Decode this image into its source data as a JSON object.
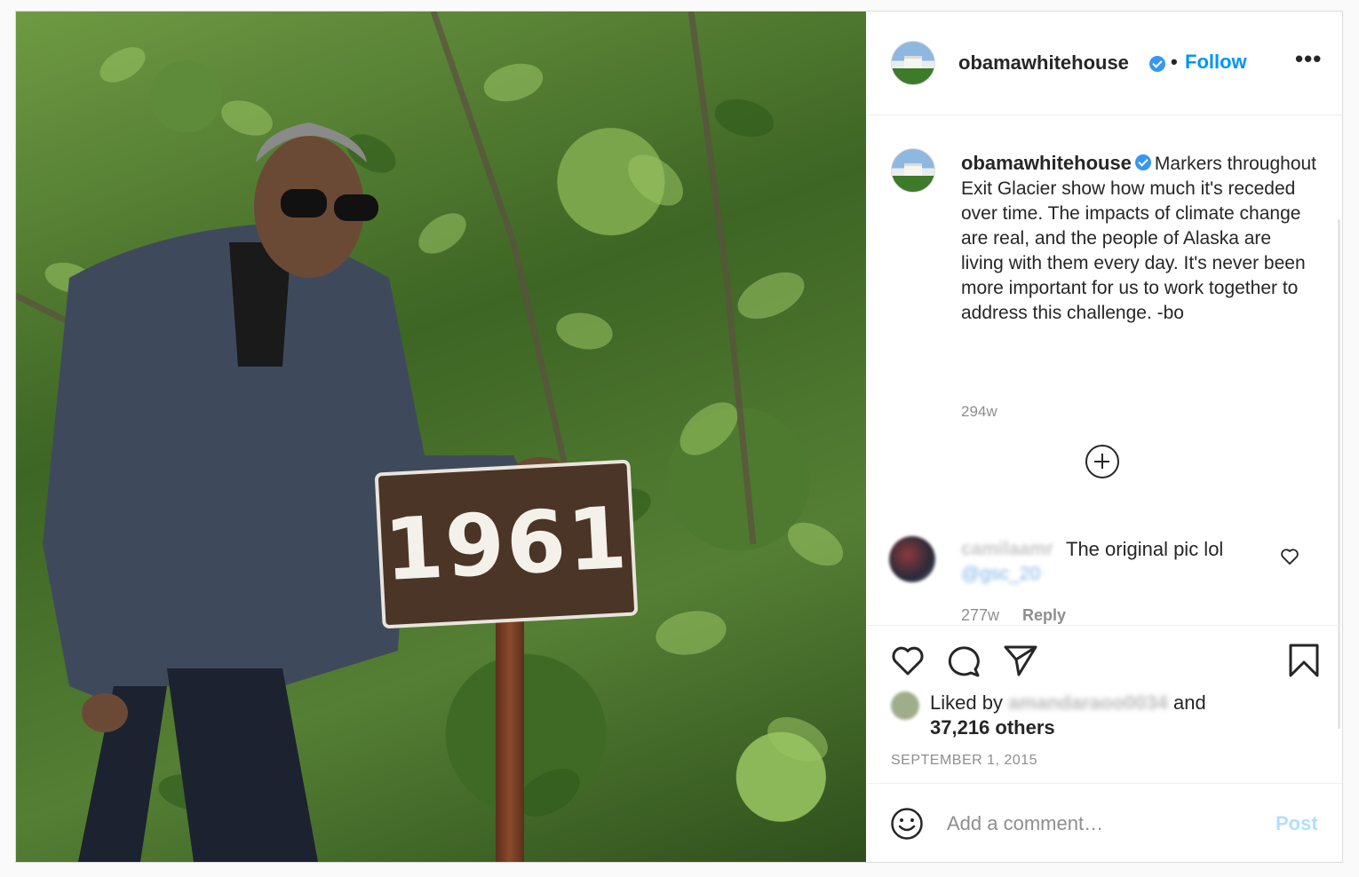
{
  "photo": {
    "alt": "Man in sunglasses and dark jacket posing beside a 1961 marker sign in green foliage",
    "sign_text": "1961"
  },
  "header": {
    "username": "obamawhitehouse",
    "dot": "•",
    "follow_label": "Follow",
    "more_label": "•••"
  },
  "caption": {
    "username": "obamawhitehouse",
    "text": "Markers throughout Exit Glacier show how much it's receded over time. The impacts of climate change are real, and the people of Alaska are living with them every day. It's never been more important for us to work together to address this challenge. -bo",
    "time": "294w"
  },
  "comment": {
    "username": "camilaamr",
    "text": "The original pic lol",
    "mention": "@gsc_20",
    "time": "277w",
    "reply_label": "Reply"
  },
  "likes": {
    "prefix": "Liked by",
    "liker": "amandaraoo0034",
    "suffix": "and",
    "count": "37,216 others"
  },
  "post_date": "SEPTEMBER 1, 2015",
  "add_comment": {
    "placeholder": "Add a comment…",
    "post_label": "Post"
  },
  "colors": {
    "accent": "#0095f6",
    "verified": "#3897f0",
    "muted": "#8e8e8e",
    "post_disabled": "#b2dffc"
  },
  "icons": {
    "like": "heart-icon",
    "comment": "comment-bubble-icon",
    "share": "paper-plane-icon",
    "save": "bookmark-icon",
    "emoji": "smiley-icon",
    "more": "ellipsis-icon",
    "expand": "plus-circle-icon"
  }
}
